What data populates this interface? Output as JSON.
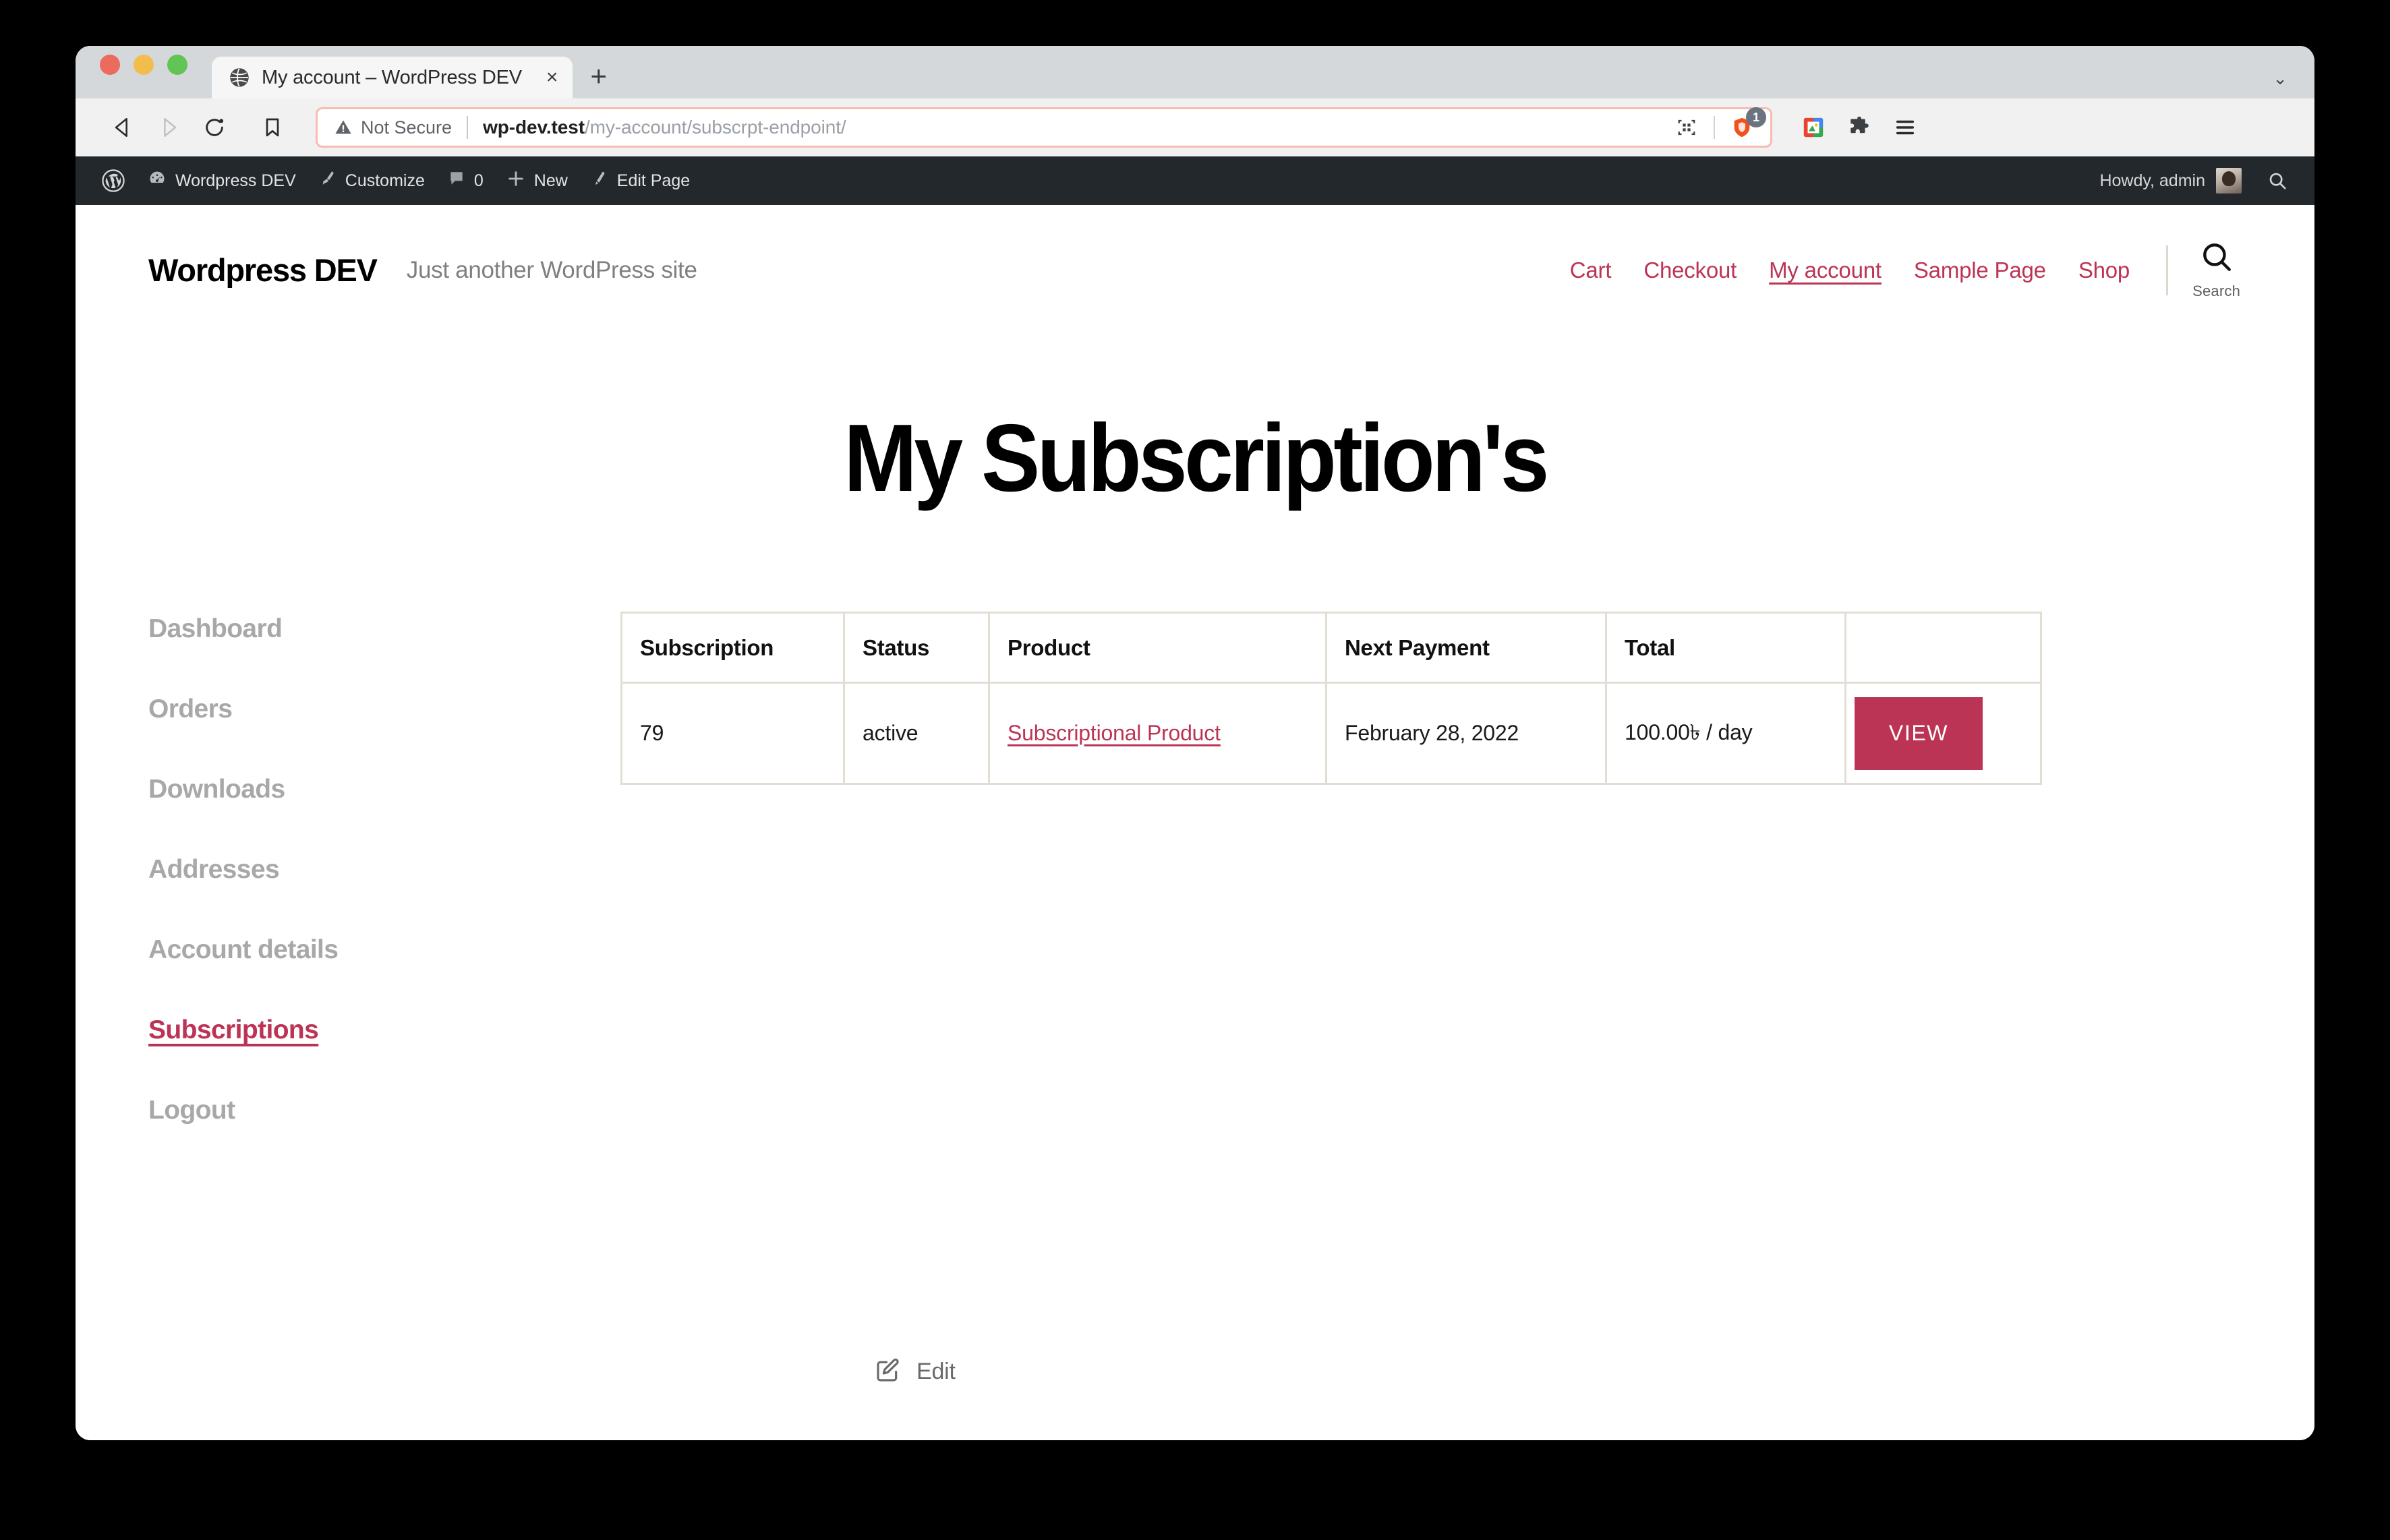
{
  "browser": {
    "tab": {
      "title": "My account – WordPress DEV",
      "close_label": "×"
    },
    "new_tab_label": "+",
    "tab_list_label": "⌄",
    "omnibox": {
      "security_label": "Not Secure",
      "url_host": "wp-dev.test",
      "url_path": "/my-account/subscrpt-endpoint/",
      "shield_badge": "1"
    },
    "icons": {
      "back": "back-arrow-icon",
      "forward": "forward-arrow-icon",
      "reload": "reload-icon",
      "bookmark": "bookmark-icon",
      "qr": "qr-code-icon",
      "shield": "brave-shield-icon",
      "extension_photos": "photos-extension-icon",
      "extension_puzzle": "extensions-puzzle-icon",
      "menu": "hamburger-menu-icon"
    }
  },
  "adminbar": {
    "logo": "wordpress-logo-icon",
    "items": [
      {
        "label": "Wordpress DEV",
        "icon": "dashboard-icon"
      },
      {
        "label": "Customize",
        "icon": "paintbrush-icon"
      },
      {
        "label": "0",
        "icon": "comment-bubble-icon"
      },
      {
        "label": "New",
        "icon": "plus-icon"
      },
      {
        "label": "Edit Page",
        "icon": "pencil-icon"
      }
    ],
    "howdy": "Howdy, admin",
    "search_icon": "search-icon"
  },
  "site": {
    "title": "Wordpress DEV",
    "tagline": "Just another WordPress site",
    "nav": [
      {
        "label": "Cart",
        "active": false
      },
      {
        "label": "Checkout",
        "active": false
      },
      {
        "label": "My account",
        "active": true
      },
      {
        "label": "Sample Page",
        "active": false
      },
      {
        "label": "Shop",
        "active": false
      }
    ],
    "search_label": "Search"
  },
  "page": {
    "title": "My Subscription's",
    "edit_label": "Edit"
  },
  "account_nav": [
    {
      "label": "Dashboard",
      "active": false
    },
    {
      "label": "Orders",
      "active": false
    },
    {
      "label": "Downloads",
      "active": false
    },
    {
      "label": "Addresses",
      "active": false
    },
    {
      "label": "Account details",
      "active": false
    },
    {
      "label": "Subscriptions",
      "active": true
    },
    {
      "label": "Logout",
      "active": false
    }
  ],
  "subscriptions_table": {
    "headers": [
      "Subscription",
      "Status",
      "Product",
      "Next Payment",
      "Total",
      ""
    ],
    "rows": [
      {
        "subscription": "79",
        "status": "active",
        "product": "Subscriptional Product",
        "next_payment": "February 28, 2022",
        "total": "100.00৳  / day",
        "action_label": "VIEW"
      }
    ]
  },
  "colors": {
    "accent": "#bc3455",
    "adminbar_bg": "#23282d",
    "table_border": "#e3ded3",
    "muted_text": "#a8a8a8"
  }
}
